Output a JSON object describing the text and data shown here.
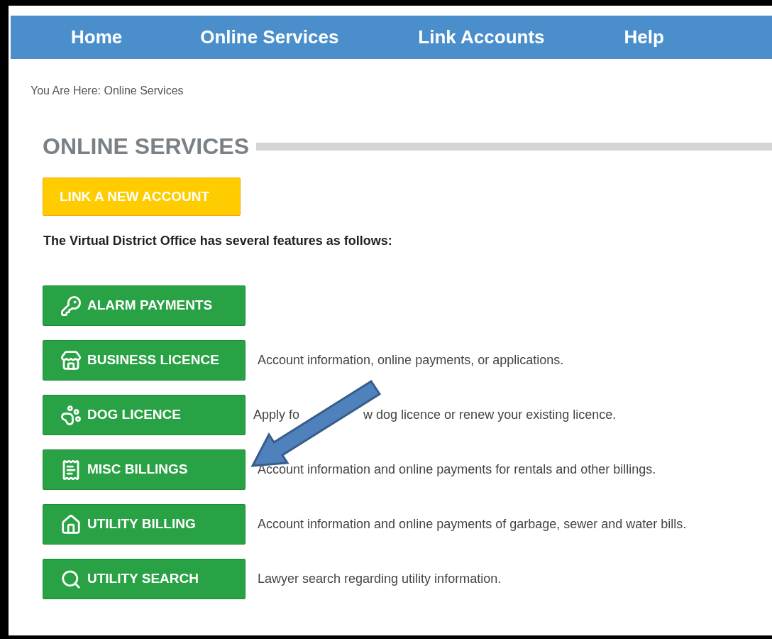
{
  "nav": [
    "Home",
    "Online Services",
    "Link Accounts",
    "Help"
  ],
  "breadcrumb": "You Are Here: Online Services",
  "heading": "ONLINE SERVICES",
  "link_button": "LINK A NEW ACCOUNT",
  "intro": "The Virtual District Office has several features as follows:",
  "services": [
    {
      "label": "ALARM PAYMENTS"
    },
    {
      "label": "BUSINESS LICENCE",
      "description": [
        "Account information, online payments, or applications."
      ]
    },
    {
      "label": "DOG LICENCE",
      "description": [
        "Apply fo",
        "w dog licence or renew your existing licence."
      ]
    },
    {
      "label": "MISC BILLINGS",
      "description": [
        "Account information and online payments for rentals and other billings."
      ]
    },
    {
      "label": "UTILITY BILLING",
      "description": [
        "Account information and online payments of garbage, sewer and water bills."
      ]
    },
    {
      "label": "UTILITY SEARCH",
      "description": [
        "Lawyer search regarding utility information."
      ]
    }
  ]
}
